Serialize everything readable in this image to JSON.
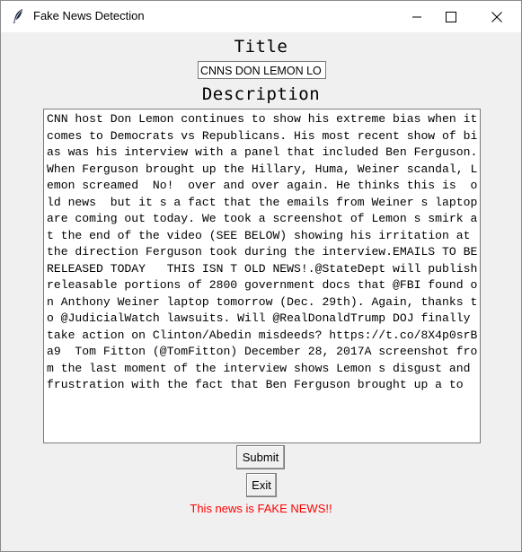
{
  "window": {
    "title": "Fake News Detection",
    "icon": "feather-icon"
  },
  "form": {
    "title_label": "Title",
    "title_value": "CNNS DON LEMON LO",
    "description_label": "Description",
    "description_value": "CNN host Don Lemon continues to show his extreme bias when it comes to Democrats vs Republicans. His most recent show of bias was his interview with a panel that included Ben Ferguson. When Ferguson brought up the Hillary, Huma, Weiner scandal, Lemon screamed  No!  over and over again. He thinks this is  old news  but it s a fact that the emails from Weiner s laptop are coming out today. We took a screenshot of Lemon s smirk at the end of the video (SEE BELOW) showing his irritation at the direction Ferguson took during the interview.EMAILS TO BE RELEASED TODAY   THIS ISN T OLD NEWS!.@StateDept will publish releasable portions of 2800 government docs that @FBI found on Anthony Weiner laptop tomorrow (Dec. 29th). Again, thanks to @JudicialWatch lawsuits. Will @RealDonaldTrump DOJ finally take action on Clinton/Abedin misdeeds? https://t.co/8X4p0srBa9  Tom Fitton (@TomFitton) December 28, 2017A screenshot from the last moment of the interview shows Lemon s disgust and frustration with the fact that Ben Ferguson brought up a to",
    "submit_label": "Submit",
    "exit_label": "Exit"
  },
  "result": {
    "text": "This news is FAKE NEWS!!",
    "color": "#ff0000"
  }
}
